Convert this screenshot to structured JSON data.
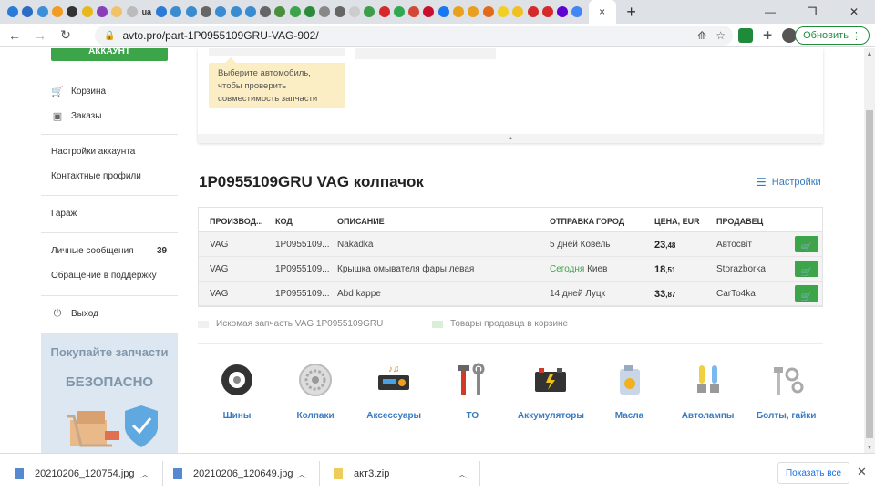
{
  "browser": {
    "tab_icons": [
      {
        "name": "edge-icon",
        "color": "#2b7bd6"
      },
      {
        "name": "firefox-icon",
        "color": "#2b6cc4"
      },
      {
        "name": "edge-icon",
        "color": "#3c8fd8"
      },
      {
        "name": "bitcoin-icon",
        "color": "#f29c1f"
      },
      {
        "name": "document-icon",
        "color": "#333"
      },
      {
        "name": "grid-icon",
        "color": "#e8b81a"
      },
      {
        "name": "square-icon",
        "color": "#8a3fb8"
      },
      {
        "name": "circle-icon",
        "color": "#f0c36a"
      },
      {
        "name": "page-icon",
        "color": "#bbb"
      },
      {
        "name": "ua-text",
        "text": "ua"
      },
      {
        "name": "globe-icon",
        "color": "#2b7bd6"
      },
      {
        "name": "edge-icon",
        "color": "#3a8bd0"
      },
      {
        "name": "edge-icon",
        "color": "#3a8bd0"
      },
      {
        "name": "globe-icon",
        "color": "#666"
      },
      {
        "name": "edge-icon",
        "color": "#3a8bd0"
      },
      {
        "name": "edge-icon",
        "color": "#3a8bd0"
      },
      {
        "name": "edge-icon",
        "color": "#3a8bd0"
      },
      {
        "name": "globe-icon",
        "color": "#666"
      },
      {
        "name": "image-icon",
        "color": "#4a8f3a"
      },
      {
        "name": "flag-icon",
        "color": "#3ca54a"
      },
      {
        "name": "flag-icon",
        "color": "#2c8a3a"
      },
      {
        "name": "shield-icon",
        "color": "#888"
      },
      {
        "name": "dollar-icon",
        "color": "#666"
      },
      {
        "name": "page-icon",
        "color": "#ccc"
      },
      {
        "name": "flag-icon",
        "color": "#3c9e4a"
      },
      {
        "name": "e-icon",
        "color": "#d62a2a"
      },
      {
        "name": "c-icon",
        "color": "#2fa84f"
      },
      {
        "name": "gmail-icon",
        "color": "#d44638"
      },
      {
        "name": "d-icon",
        "color": "#c8102e"
      },
      {
        "name": "facebook-icon",
        "color": "#1877f2"
      },
      {
        "name": "car-icon",
        "color": "#e8a020"
      },
      {
        "name": "car-icon",
        "color": "#e8a020"
      },
      {
        "name": "fox-icon",
        "color": "#e06a1c"
      },
      {
        "name": "face-icon",
        "color": "#f0d020"
      },
      {
        "name": "arrow-icon",
        "color": "#f0c020"
      },
      {
        "name": "opera-icon",
        "color": "#d62a2a"
      },
      {
        "name": "opera-icon",
        "color": "#d62a2a"
      },
      {
        "name": "yahoo-icon",
        "color": "#6001d2"
      },
      {
        "name": "google-icon",
        "color": "#4285f4"
      }
    ],
    "active_tab_close": "×",
    "new_tab": "+",
    "url": "avto.pro/part-1P0955109GRU-VAG-902/",
    "update_button": "Обновить",
    "window_minimize": "—",
    "window_restore": "❐",
    "window_close": "✕"
  },
  "sidebar": {
    "account_button": "АККАУНТ",
    "cart": "Корзина",
    "orders": "Заказы",
    "account_settings": "Настройки аккаунта",
    "contact_profiles": "Контактные профили",
    "garage": "Гараж",
    "messages": "Личные сообщения",
    "messages_count": "39",
    "support": "Обращение в поддержку",
    "logout": "Выход",
    "promo_line1": "Покупайте запчасти",
    "promo_line2": "БЕЗОПАСНО"
  },
  "selector": {
    "tip": "Выберите автомобиль, чтобы проверить совместимость запчасти"
  },
  "page_title": "1P0955109GRU VAG колпачок",
  "settings_link": "Настройки",
  "table": {
    "headers": {
      "maker": "ПРОИЗВОД...",
      "code": "КОД",
      "description": "ОПИСАНИЕ",
      "shipping": "ОТПРАВКА",
      "city": "ГОРОД",
      "price": "ЦЕНА, EUR",
      "seller": "ПРОДАВЕЦ"
    },
    "rows": [
      {
        "maker": "VAG",
        "code": "1P0955109...",
        "description": "Nakadka",
        "ship": "5 дней",
        "city": "Ковель",
        "price_int": "23",
        "price_dec": ",48",
        "seller": "Автосвіт",
        "today": false
      },
      {
        "maker": "VAG",
        "code": "1P0955109...",
        "description": "Крышка омывателя фары левая",
        "ship": "Сегодня",
        "city": "Киев",
        "price_int": "18",
        "price_dec": ",51",
        "seller": "Storazborka",
        "today": true
      },
      {
        "maker": "VAG",
        "code": "1P0955109...",
        "description": "Abd kappe",
        "ship": "14 дней",
        "city": "Луцк",
        "price_int": "33",
        "price_dec": ",87",
        "seller": "CarTo4ka",
        "today": false
      }
    ]
  },
  "legend": {
    "searched": "Искомая запчасть VAG 1P0955109GRU",
    "in_cart": "Товары продавца в корзине",
    "searched_color": "#f0f0f0",
    "in_cart_color": "#d8efd9"
  },
  "categories": [
    {
      "label": "Шины",
      "icon": "tire-icon"
    },
    {
      "label": "Колпаки",
      "icon": "hubcap-icon"
    },
    {
      "label": "Аксессуары",
      "icon": "car-radio-icon"
    },
    {
      "label": "ТО",
      "icon": "tools-icon"
    },
    {
      "label": "Аккумуляторы",
      "icon": "battery-icon"
    },
    {
      "label": "Масла",
      "icon": "oil-can-icon"
    },
    {
      "label": "Автолампы",
      "icon": "bulbs-icon"
    },
    {
      "label": "Болты, гайки",
      "icon": "bolts-icon"
    }
  ],
  "downloads": [
    {
      "name": "20210206_120754.jpg"
    },
    {
      "name": "20210206_120649.jpg"
    },
    {
      "name": "акт3.zip"
    }
  ],
  "show_all": "Показать все",
  "colors": {
    "accent_green": "#3ca54a",
    "link_blue": "#3a7bbf"
  }
}
